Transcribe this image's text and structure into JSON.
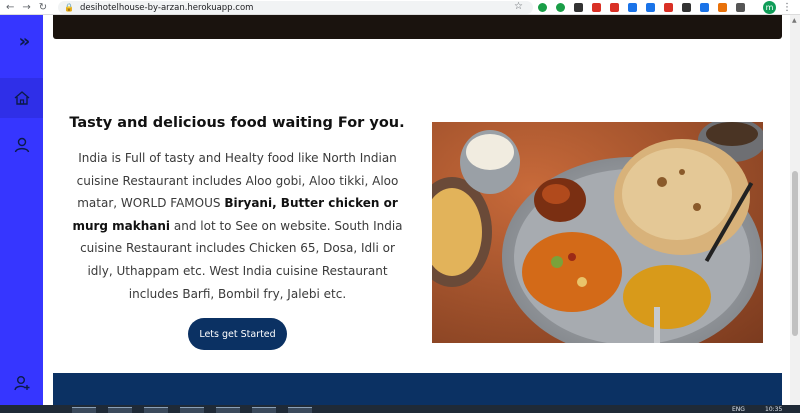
{
  "browser": {
    "url": "desihotelhouse-by-arzan.herokuapp.com",
    "back_icon": "arrow-left-icon",
    "forward_icon": "arrow-right-icon",
    "reload_icon": "reload-icon",
    "profile_initial": "m",
    "extension_colors": [
      "#1a9e47",
      "#1a9e47",
      "#333333",
      "#d93025",
      "#d93025",
      "#1a73e8",
      "#1a73e8",
      "#d93025",
      "#333333",
      "#1a73e8",
      "#e8710a",
      "#555555"
    ]
  },
  "sidebar": {
    "bg_color": "#3636ff",
    "items": [
      {
        "icon": "double-chevron-right-icon",
        "glyph": "»"
      },
      {
        "icon": "home-icon"
      },
      {
        "icon": "user-icon"
      },
      {
        "icon": "add-user-icon"
      }
    ]
  },
  "section": {
    "title": "Tasty and delicious food waiting For you.",
    "text_parts": {
      "p1": "India is Full of tasty and Healty food like North Indian cuisine Restaurant includes Aloo gobi, Aloo tikki, Aloo matar, WORLD FAMOUS ",
      "bold1": "Biryani, Butter chicken or murg makhani",
      "p2": " and lot to See on website. South India cuisine Restaurant includes Chicken 65, Dosa, Idli or idly, Uthappam etc. West India cuisine Restaurant includes Barfi, Bombil fry, Jalebi etc."
    },
    "cta_label": "Lets get Started",
    "image_alt": "thali-plate-image"
  },
  "colors": {
    "accent": "#3636ff",
    "navy": "#0b3163",
    "banner": "#1a130e"
  },
  "taskbar": {
    "tray_text_1": "ENG",
    "tray_text_2": "10:35"
  }
}
